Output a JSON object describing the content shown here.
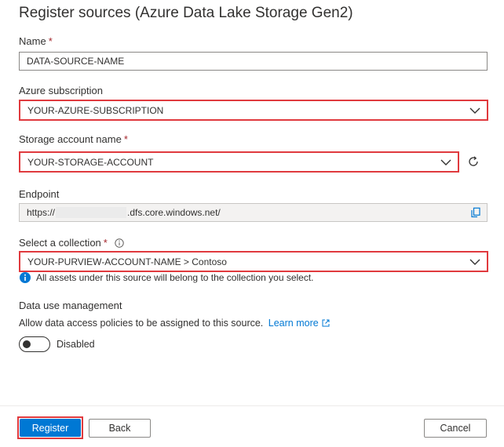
{
  "page": {
    "title": "Register sources (Azure Data Lake Storage Gen2)"
  },
  "form": {
    "name": {
      "label": "Name",
      "required_mark": "*",
      "value": "DATA-SOURCE-NAME"
    },
    "subscription": {
      "label": "Azure subscription",
      "value": "YOUR-AZURE-SUBSCRIPTION"
    },
    "storage_account": {
      "label": "Storage account name",
      "required_mark": "*",
      "value": "YOUR-STORAGE-ACCOUNT"
    },
    "endpoint": {
      "label": "Endpoint",
      "prefix": "https://",
      "suffix": ".dfs.core.windows.net/"
    },
    "collection": {
      "label": "Select a collection",
      "required_mark": "*",
      "value": "YOUR-PURVIEW-ACCOUNT-NAME > Contoso",
      "info_text": "All assets under this source will belong to the collection you select."
    },
    "data_use": {
      "heading": "Data use management",
      "description": "Allow data access policies to be assigned to this source.",
      "learn_more": "Learn more",
      "toggle_label": "Disabled",
      "toggle_on": false
    }
  },
  "footer": {
    "register_label": "Register",
    "back_label": "Back",
    "cancel_label": "Cancel"
  },
  "colors": {
    "accent": "#0078d4",
    "highlight": "#e03a3e",
    "required": "#a4262c"
  },
  "icons": {
    "dropdown": "chevron-down-icon",
    "refresh": "refresh-icon",
    "copy": "copy-icon",
    "info": "info-icon",
    "external": "external-link-icon"
  }
}
